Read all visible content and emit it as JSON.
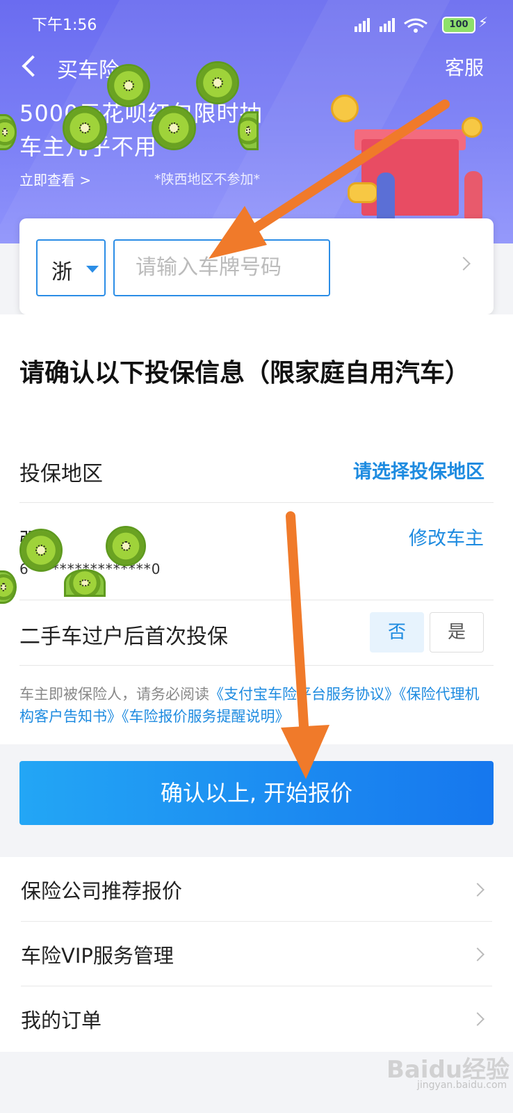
{
  "status_bar": {
    "time": "下午1:56",
    "battery": "100"
  },
  "nav": {
    "title": "买车险",
    "service": "客服"
  },
  "promo": {
    "line1": "5000元花呗红包限时抽",
    "line2": "车主几乎不用",
    "link": "立即查看 >",
    "note": "*陕西地区不参加*"
  },
  "plate": {
    "province": "浙",
    "placeholder": "请输入车牌号码"
  },
  "form": {
    "title": "请确认以下投保信息（限家庭自用汽车）",
    "region_label": "投保地区",
    "region_action": "请选择投保地区",
    "owner_name": "强",
    "owner_id": "6****************0",
    "edit_owner": "修改车主",
    "second_hand_label": "二手车过户后首次投保",
    "option_no": "否",
    "option_yes": "是",
    "agreement_prefix": "车主即被保险人，请务必阅读",
    "agreement_link1": "《支付宝车险平台服务协议》",
    "agreement_link2": "《保险代理机构客户告知书》",
    "agreement_link3": "《车险报价服务提醒说明》"
  },
  "cta": {
    "label": "确认以上, 开始报价"
  },
  "menu": {
    "items": [
      {
        "label": "保险公司推荐报价"
      },
      {
        "label": "车险VIP服务管理"
      },
      {
        "label": "我的订单"
      }
    ]
  },
  "watermark": {
    "text": "Baidu经验",
    "sub": "jingyan.baidu.com"
  },
  "colors": {
    "accent": "#1e8be0",
    "header": "#7b7ff6",
    "arrow": "#f07a2a"
  }
}
